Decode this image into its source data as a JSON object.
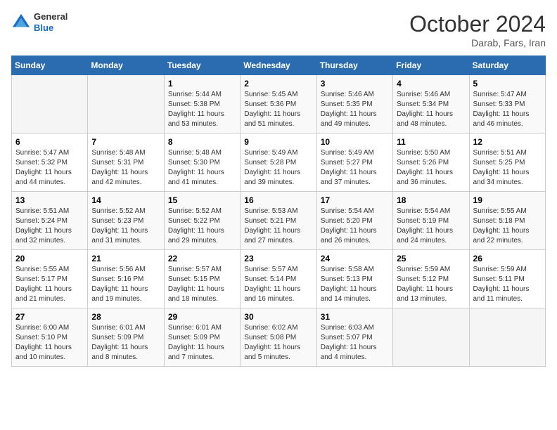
{
  "header": {
    "logo_general": "General",
    "logo_blue": "Blue",
    "month_title": "October 2024",
    "subtitle": "Darab, Fars, Iran"
  },
  "days_of_week": [
    "Sunday",
    "Monday",
    "Tuesday",
    "Wednesday",
    "Thursday",
    "Friday",
    "Saturday"
  ],
  "weeks": [
    [
      {
        "day": "",
        "info": ""
      },
      {
        "day": "",
        "info": ""
      },
      {
        "day": "1",
        "info": "Sunrise: 5:44 AM\nSunset: 5:38 PM\nDaylight: 11 hours and 53 minutes."
      },
      {
        "day": "2",
        "info": "Sunrise: 5:45 AM\nSunset: 5:36 PM\nDaylight: 11 hours and 51 minutes."
      },
      {
        "day": "3",
        "info": "Sunrise: 5:46 AM\nSunset: 5:35 PM\nDaylight: 11 hours and 49 minutes."
      },
      {
        "day": "4",
        "info": "Sunrise: 5:46 AM\nSunset: 5:34 PM\nDaylight: 11 hours and 48 minutes."
      },
      {
        "day": "5",
        "info": "Sunrise: 5:47 AM\nSunset: 5:33 PM\nDaylight: 11 hours and 46 minutes."
      }
    ],
    [
      {
        "day": "6",
        "info": "Sunrise: 5:47 AM\nSunset: 5:32 PM\nDaylight: 11 hours and 44 minutes."
      },
      {
        "day": "7",
        "info": "Sunrise: 5:48 AM\nSunset: 5:31 PM\nDaylight: 11 hours and 42 minutes."
      },
      {
        "day": "8",
        "info": "Sunrise: 5:48 AM\nSunset: 5:30 PM\nDaylight: 11 hours and 41 minutes."
      },
      {
        "day": "9",
        "info": "Sunrise: 5:49 AM\nSunset: 5:28 PM\nDaylight: 11 hours and 39 minutes."
      },
      {
        "day": "10",
        "info": "Sunrise: 5:49 AM\nSunset: 5:27 PM\nDaylight: 11 hours and 37 minutes."
      },
      {
        "day": "11",
        "info": "Sunrise: 5:50 AM\nSunset: 5:26 PM\nDaylight: 11 hours and 36 minutes."
      },
      {
        "day": "12",
        "info": "Sunrise: 5:51 AM\nSunset: 5:25 PM\nDaylight: 11 hours and 34 minutes."
      }
    ],
    [
      {
        "day": "13",
        "info": "Sunrise: 5:51 AM\nSunset: 5:24 PM\nDaylight: 11 hours and 32 minutes."
      },
      {
        "day": "14",
        "info": "Sunrise: 5:52 AM\nSunset: 5:23 PM\nDaylight: 11 hours and 31 minutes."
      },
      {
        "day": "15",
        "info": "Sunrise: 5:52 AM\nSunset: 5:22 PM\nDaylight: 11 hours and 29 minutes."
      },
      {
        "day": "16",
        "info": "Sunrise: 5:53 AM\nSunset: 5:21 PM\nDaylight: 11 hours and 27 minutes."
      },
      {
        "day": "17",
        "info": "Sunrise: 5:54 AM\nSunset: 5:20 PM\nDaylight: 11 hours and 26 minutes."
      },
      {
        "day": "18",
        "info": "Sunrise: 5:54 AM\nSunset: 5:19 PM\nDaylight: 11 hours and 24 minutes."
      },
      {
        "day": "19",
        "info": "Sunrise: 5:55 AM\nSunset: 5:18 PM\nDaylight: 11 hours and 22 minutes."
      }
    ],
    [
      {
        "day": "20",
        "info": "Sunrise: 5:55 AM\nSunset: 5:17 PM\nDaylight: 11 hours and 21 minutes."
      },
      {
        "day": "21",
        "info": "Sunrise: 5:56 AM\nSunset: 5:16 PM\nDaylight: 11 hours and 19 minutes."
      },
      {
        "day": "22",
        "info": "Sunrise: 5:57 AM\nSunset: 5:15 PM\nDaylight: 11 hours and 18 minutes."
      },
      {
        "day": "23",
        "info": "Sunrise: 5:57 AM\nSunset: 5:14 PM\nDaylight: 11 hours and 16 minutes."
      },
      {
        "day": "24",
        "info": "Sunrise: 5:58 AM\nSunset: 5:13 PM\nDaylight: 11 hours and 14 minutes."
      },
      {
        "day": "25",
        "info": "Sunrise: 5:59 AM\nSunset: 5:12 PM\nDaylight: 11 hours and 13 minutes."
      },
      {
        "day": "26",
        "info": "Sunrise: 5:59 AM\nSunset: 5:11 PM\nDaylight: 11 hours and 11 minutes."
      }
    ],
    [
      {
        "day": "27",
        "info": "Sunrise: 6:00 AM\nSunset: 5:10 PM\nDaylight: 11 hours and 10 minutes."
      },
      {
        "day": "28",
        "info": "Sunrise: 6:01 AM\nSunset: 5:09 PM\nDaylight: 11 hours and 8 minutes."
      },
      {
        "day": "29",
        "info": "Sunrise: 6:01 AM\nSunset: 5:09 PM\nDaylight: 11 hours and 7 minutes."
      },
      {
        "day": "30",
        "info": "Sunrise: 6:02 AM\nSunset: 5:08 PM\nDaylight: 11 hours and 5 minutes."
      },
      {
        "day": "31",
        "info": "Sunrise: 6:03 AM\nSunset: 5:07 PM\nDaylight: 11 hours and 4 minutes."
      },
      {
        "day": "",
        "info": ""
      },
      {
        "day": "",
        "info": ""
      }
    ]
  ]
}
